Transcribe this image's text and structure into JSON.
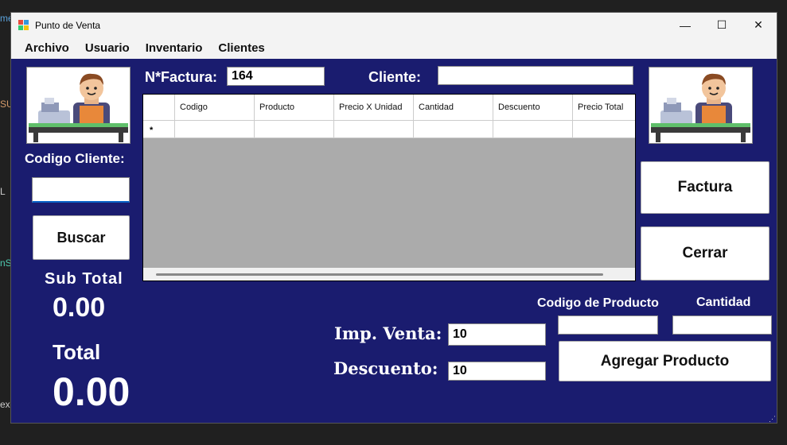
{
  "background": {
    "fragments": [
      "me",
      "SU",
      "L",
      "nS",
      "ex"
    ]
  },
  "window": {
    "title": "Punto de Venta",
    "controls": {
      "minimize": "—",
      "maximize": "☐",
      "close": "✕"
    }
  },
  "menu": [
    "Archivo",
    "Usuario",
    "Inventario",
    "Clientes"
  ],
  "invoice": {
    "label": "N*Factura:",
    "value": "164"
  },
  "client": {
    "label": "Cliente:",
    "value": ""
  },
  "left": {
    "codigo_cliente_label": "Codigo Cliente:",
    "codigo_cliente_value": "",
    "buscar_button": "Buscar",
    "subtotal_label": "Sub Total",
    "subtotal_value": "0.00",
    "total_label": "Total",
    "total_value": "0.00"
  },
  "grid": {
    "new_row_marker": "*",
    "columns": [
      "Codigo",
      "Producto",
      "Precio X Unidad",
      "Cantidad",
      "Descuento",
      "Precio Total"
    ]
  },
  "right": {
    "factura_button": "Factura",
    "cerrar_button": "Cerrar",
    "codigo_producto_label": "Codigo de Producto",
    "cantidad_label": "Cantidad",
    "codigo_producto_value": "",
    "cantidad_value": "",
    "agregar_button": "Agregar Producto"
  },
  "bottom": {
    "imp_venta_label": "Imp. Venta:",
    "imp_venta_value": "10",
    "descuento_label": "Descuento:",
    "descuento_value": "10"
  },
  "colors": {
    "window_bg": "#1a1c6f",
    "grid_bg": "#ababab"
  },
  "icons": [
    "cashier-icon",
    "cashier-icon"
  ]
}
